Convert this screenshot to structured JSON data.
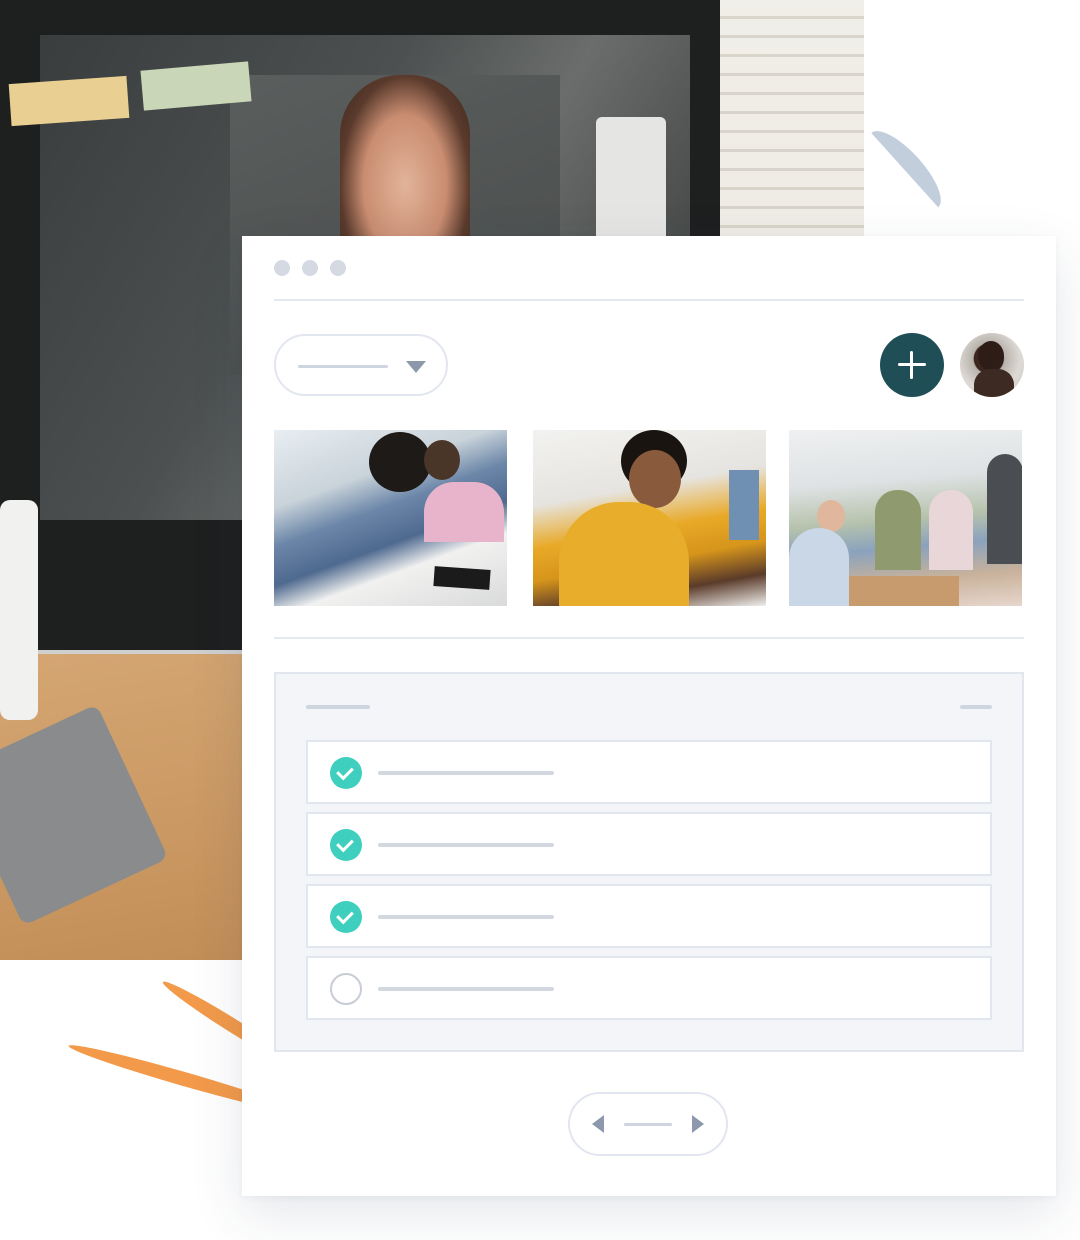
{
  "background": {
    "description_icon": "monitor-video-call-photo"
  },
  "colors": {
    "accent": "#1f4e57",
    "check_done": "#3fcfbe",
    "decor_orange": "#f29a4a",
    "decor_blue": "#c3cedd",
    "placeholder_bar": "#cfd5df"
  },
  "window": {
    "dots": [
      "window-dot",
      "window-dot",
      "window-dot"
    ]
  },
  "toolbar": {
    "dropdown_icon": "chevron-down-icon",
    "add_icon": "plus-icon",
    "avatar_icon": "user-avatar"
  },
  "gallery": {
    "images": [
      "photo-students-writing",
      "photo-student-laptop",
      "photo-group-discussion"
    ]
  },
  "tasks": [
    {
      "done": true
    },
    {
      "done": true
    },
    {
      "done": true
    },
    {
      "done": false
    }
  ],
  "pager": {
    "prev_icon": "chevron-left-icon",
    "next_icon": "chevron-right-icon"
  }
}
